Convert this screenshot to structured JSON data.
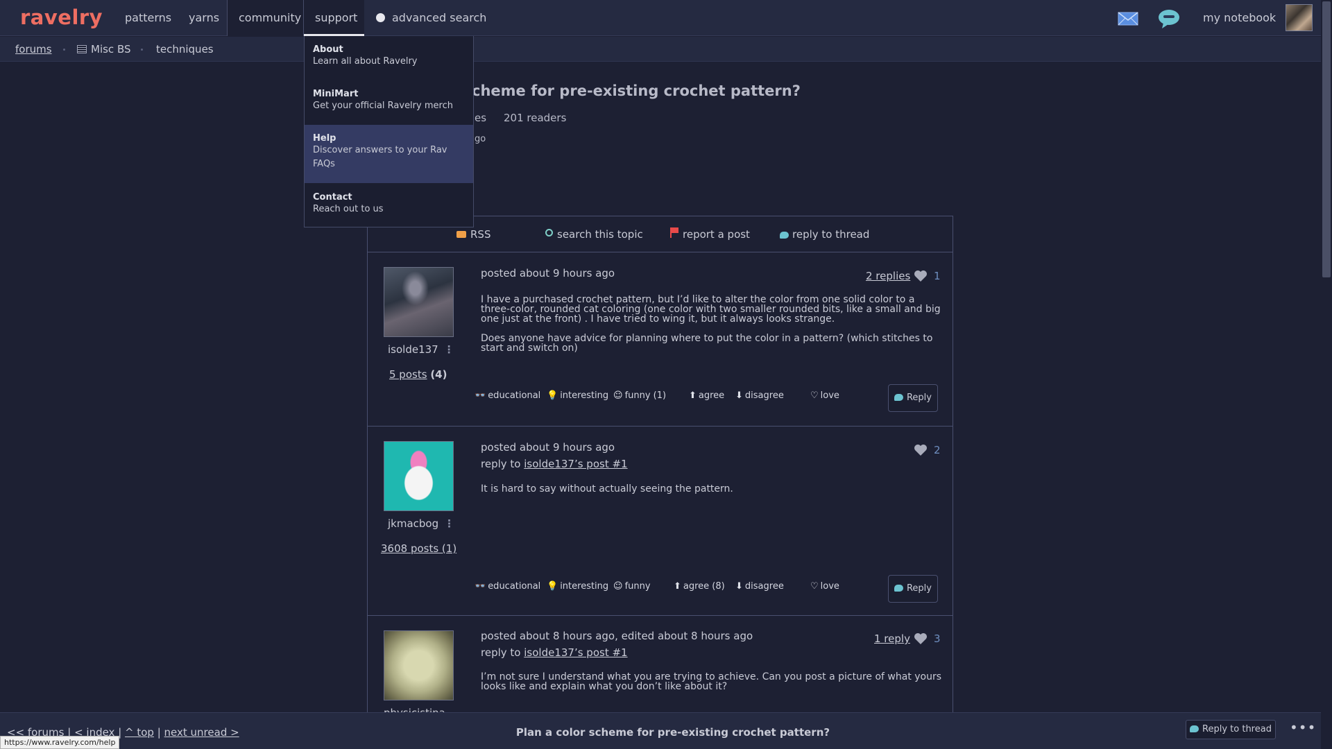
{
  "nav": {
    "logo": "ravelry",
    "items": [
      "patterns",
      "yarns",
      "community",
      "support"
    ],
    "advanced_search": "advanced search",
    "my_notebook": "my notebook"
  },
  "breadcrumb": {
    "forums": "forums",
    "board": "Misc BS",
    "tag": "techniques"
  },
  "dropdown": {
    "items": [
      {
        "title": "About",
        "desc": "Learn all about Ravelry"
      },
      {
        "title": "MiniMart",
        "desc": "Get your official Ravelry merch"
      },
      {
        "title": "Help",
        "desc": "Discover answers to your Rav",
        "desc2": "FAQs"
      },
      {
        "title": "Contact",
        "desc": "Reach out to us"
      }
    ]
  },
  "thread": {
    "title_visible": "cheme for pre-existing crochet pattern?",
    "meta_partial": "es",
    "readers": "201 readers",
    "ago_partial": "go"
  },
  "toolbar": {
    "rss": "RSS",
    "search": "search this topic",
    "report": "report a post",
    "reply": "reply to thread"
  },
  "posts": [
    {
      "username": "isolde137",
      "post_count": "5 posts",
      "post_count_extra": "(4)",
      "posted": "posted about 9 hours ago",
      "replies": "2 replies",
      "likes": "1",
      "body": [
        "I have a purchased crochet pattern, but I’d like to alter the color from one solid color to a three-color, rounded cat coloring (one color with two smaller rounded bits, like a small and big one just at the front) . I have tried to wing it, but it always looks strange.",
        "Does anyone have advice for planning where to put the color in a pattern? (which stitches to start and switch on)"
      ],
      "reactions": {
        "educational": "educational",
        "interesting": "interesting",
        "funny": "funny (1)",
        "agree": "agree",
        "disagree": "disagree",
        "love": "love"
      },
      "reply_btn": "Reply"
    },
    {
      "username": "jkmacbog",
      "post_count": "3608 posts (1)",
      "posted": "posted about 9 hours ago",
      "reply_to_label": "reply to",
      "reply_to_link": "isolde137’s post #1",
      "likes": "2",
      "body": [
        "It is hard to say without actually seeing the pattern."
      ],
      "reactions": {
        "educational": "educational",
        "interesting": "interesting",
        "funny": "funny",
        "agree": "agree (8)",
        "disagree": "disagree",
        "love": "love"
      },
      "reply_btn": "Reply"
    },
    {
      "username": "physicistina",
      "posted": "posted about 8 hours ago, edited about 8 hours ago",
      "reply_to_label": "reply to",
      "reply_to_link": "isolde137’s post #1",
      "replies": "1 reply",
      "likes": "3",
      "body": [
        "I’m not sure I understand what you are trying to achieve. Can you post a picture of what yours looks like and explain what you don’t like about it?"
      ]
    }
  ],
  "bottom": {
    "forums": "<< forums",
    "index": "< index",
    "top": "^ top",
    "next_unread": "next unread >",
    "title": "Plan a color scheme for pre-existing crochet pattern?",
    "reply": "Reply to thread",
    "more": "•••"
  },
  "status_url": "https://www.ravelry.com/help"
}
